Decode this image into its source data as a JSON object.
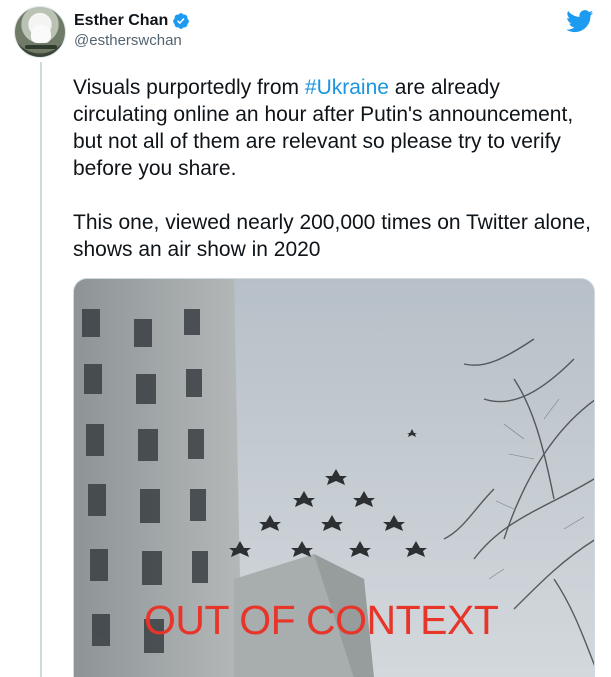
{
  "author": {
    "name": "Esther Chan",
    "handle": "@estherswchan",
    "verified": true,
    "avatar_icon": "cat-on-scooter-avatar"
  },
  "tweet": {
    "text_before_tag": "Visuals purportedly from ",
    "hashtag": "#Ukraine",
    "text_after_tag": " are already circulating online an hour after Putin's announcement, but not all of them are relevant so please try to verify before you share.",
    "text_para2": "This one, viewed nearly 200,000 times on Twitter alone, shows an air show in 2020"
  },
  "media": {
    "overlay_text": "OUT OF CONTEXT"
  },
  "colors": {
    "link": "#1b95e0",
    "twitter_blue": "#1d9bf0",
    "overlay_red": "#e8352a"
  },
  "icons": {
    "brand": "twitter-bird-icon",
    "badge": "verified-badge-icon"
  }
}
